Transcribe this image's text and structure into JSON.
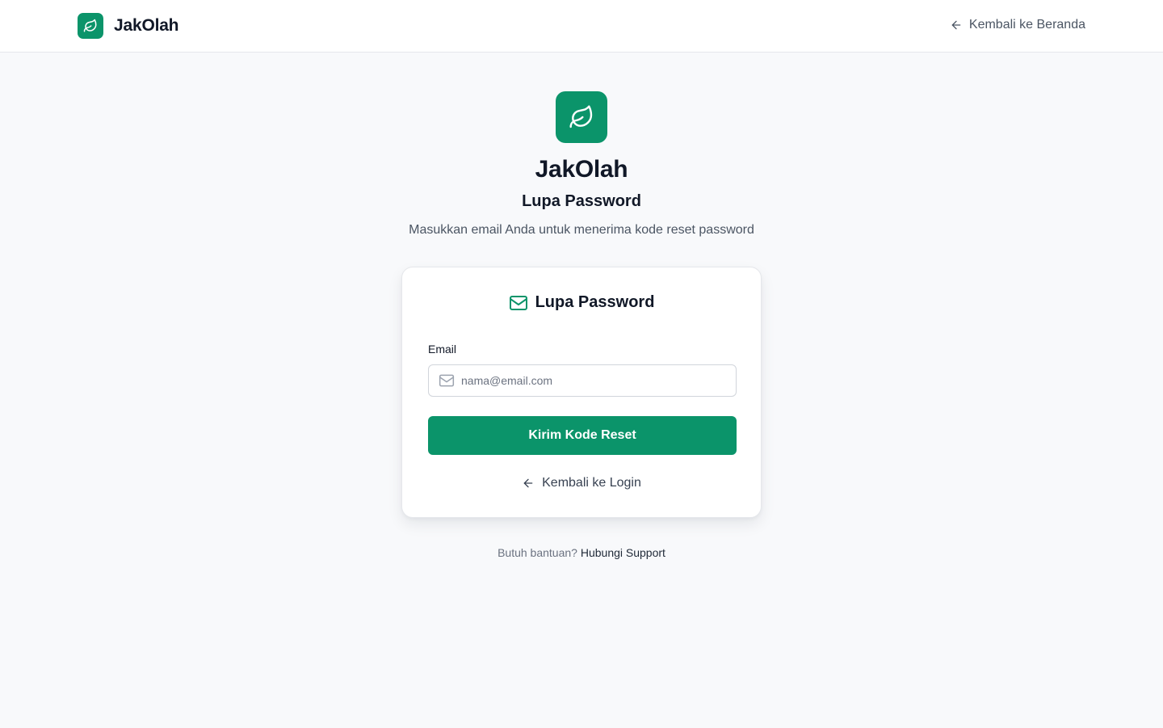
{
  "header": {
    "brand_name": "JakOlah",
    "back_home_label": "Kembali ke Beranda"
  },
  "hero": {
    "title": "JakOlah",
    "subtitle": "Lupa Password",
    "description": "Masukkan email Anda untuk menerima kode reset password"
  },
  "card": {
    "title": "Lupa Password",
    "email_label": "Email",
    "email_placeholder": "nama@email.com",
    "email_value": "",
    "submit_label": "Kirim Kode Reset",
    "back_login_label": "Kembali ke Login"
  },
  "footer": {
    "help_text": "Butuh bantuan?",
    "help_link": "Hubungi Support"
  },
  "icons": {
    "brand": "leaf-icon",
    "back": "arrow-left-icon",
    "mail": "mail-icon"
  },
  "colors": {
    "accent": "#0b946a",
    "background": "#f8f9fb",
    "text": "#111827",
    "muted": "#4b5563"
  }
}
